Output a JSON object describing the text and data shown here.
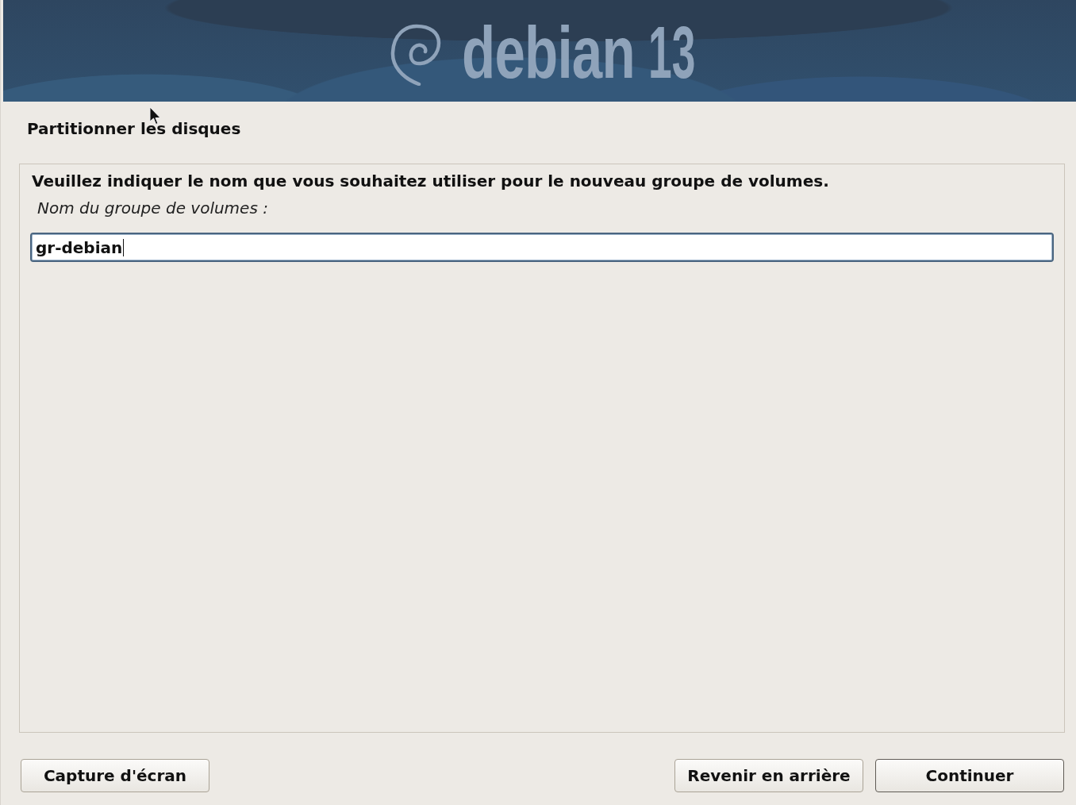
{
  "header": {
    "brand": "debian",
    "version": "13"
  },
  "step_title": "Partitionner les disques",
  "question": {
    "prompt": "Veuillez indiquer le nom que vous souhaitez utiliser pour le nouveau groupe de volumes.",
    "label": "Nom du groupe de volumes :",
    "field": {
      "value": "gr-debian",
      "focused": true
    }
  },
  "screenshot_button": {
    "label": "Capture d'écran",
    "default": false
  },
  "back_button": {
    "label": "Revenir en arrière",
    "default": false
  },
  "continue_button": {
    "label": "Continuer",
    "default": true
  },
  "pointer": {
    "visible": true
  }
}
